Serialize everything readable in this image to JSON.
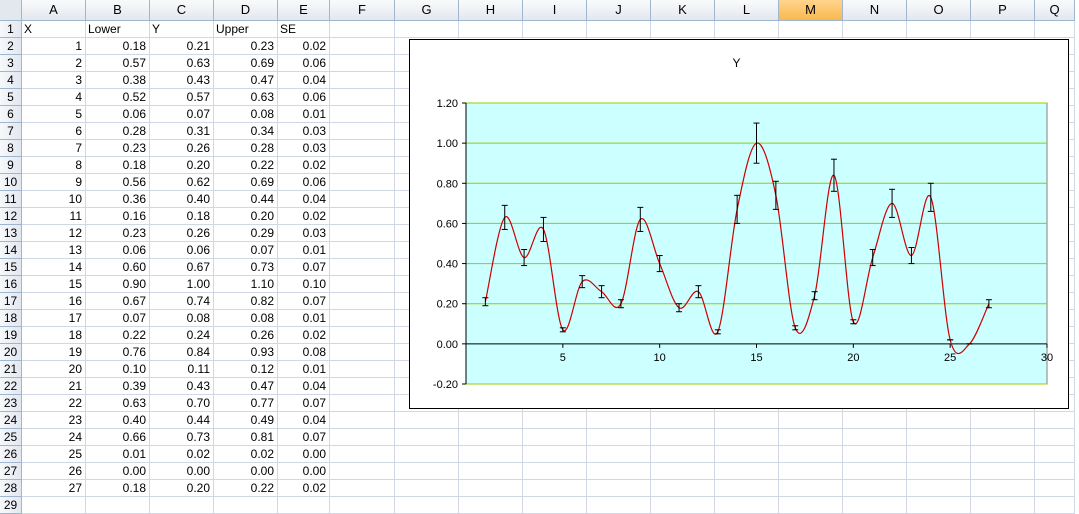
{
  "sheet": {
    "columns": [
      "A",
      "B",
      "C",
      "D",
      "E",
      "F",
      "G",
      "H",
      "I",
      "J",
      "K",
      "L",
      "M",
      "N",
      "O",
      "P",
      "Q"
    ],
    "selected_column": "M",
    "headers": [
      "X",
      "Lower",
      "Y",
      "Upper",
      "SE"
    ],
    "rows": [
      [
        "1",
        "0.18",
        "0.21",
        "0.23",
        "0.02"
      ],
      [
        "2",
        "0.57",
        "0.63",
        "0.69",
        "0.06"
      ],
      [
        "3",
        "0.38",
        "0.43",
        "0.47",
        "0.04"
      ],
      [
        "4",
        "0.52",
        "0.57",
        "0.63",
        "0.06"
      ],
      [
        "5",
        "0.06",
        "0.07",
        "0.08",
        "0.01"
      ],
      [
        "6",
        "0.28",
        "0.31",
        "0.34",
        "0.03"
      ],
      [
        "7",
        "0.23",
        "0.26",
        "0.28",
        "0.03"
      ],
      [
        "8",
        "0.18",
        "0.20",
        "0.22",
        "0.02"
      ],
      [
        "9",
        "0.56",
        "0.62",
        "0.69",
        "0.06"
      ],
      [
        "10",
        "0.36",
        "0.40",
        "0.44",
        "0.04"
      ],
      [
        "11",
        "0.16",
        "0.18",
        "0.20",
        "0.02"
      ],
      [
        "12",
        "0.23",
        "0.26",
        "0.29",
        "0.03"
      ],
      [
        "13",
        "0.06",
        "0.06",
        "0.07",
        "0.01"
      ],
      [
        "14",
        "0.60",
        "0.67",
        "0.73",
        "0.07"
      ],
      [
        "15",
        "0.90",
        "1.00",
        "1.10",
        "0.10"
      ],
      [
        "16",
        "0.67",
        "0.74",
        "0.82",
        "0.07"
      ],
      [
        "17",
        "0.07",
        "0.08",
        "0.08",
        "0.01"
      ],
      [
        "18",
        "0.22",
        "0.24",
        "0.26",
        "0.02"
      ],
      [
        "19",
        "0.76",
        "0.84",
        "0.93",
        "0.08"
      ],
      [
        "20",
        "0.10",
        "0.11",
        "0.12",
        "0.01"
      ],
      [
        "21",
        "0.39",
        "0.43",
        "0.47",
        "0.04"
      ],
      [
        "22",
        "0.63",
        "0.70",
        "0.77",
        "0.07"
      ],
      [
        "23",
        "0.40",
        "0.44",
        "0.49",
        "0.04"
      ],
      [
        "24",
        "0.66",
        "0.73",
        "0.81",
        "0.07"
      ],
      [
        "25",
        "0.01",
        "0.02",
        "0.02",
        "0.00"
      ],
      [
        "26",
        "0.00",
        "0.00",
        "0.00",
        "0.00"
      ],
      [
        "27",
        "0.18",
        "0.20",
        "0.22",
        "0.02"
      ]
    ]
  },
  "chart_data": {
    "type": "scatter",
    "title": "Y",
    "x": [
      1,
      2,
      3,
      4,
      5,
      6,
      7,
      8,
      9,
      10,
      11,
      12,
      13,
      14,
      15,
      16,
      17,
      18,
      19,
      20,
      21,
      22,
      23,
      24,
      25,
      26,
      27
    ],
    "y": [
      0.21,
      0.63,
      0.43,
      0.57,
      0.07,
      0.31,
      0.26,
      0.2,
      0.62,
      0.4,
      0.18,
      0.26,
      0.06,
      0.67,
      1.0,
      0.74,
      0.08,
      0.24,
      0.84,
      0.11,
      0.43,
      0.7,
      0.44,
      0.73,
      0.02,
      0.0,
      0.2
    ],
    "error": [
      0.02,
      0.06,
      0.04,
      0.06,
      0.01,
      0.03,
      0.03,
      0.02,
      0.06,
      0.04,
      0.02,
      0.03,
      0.01,
      0.07,
      0.1,
      0.07,
      0.01,
      0.02,
      0.08,
      0.01,
      0.04,
      0.07,
      0.04,
      0.07,
      0.0,
      0.0,
      0.02
    ],
    "xlim": [
      0,
      30
    ],
    "ylim": [
      -0.2,
      1.2
    ],
    "xticks": [
      "5",
      "10",
      "15",
      "20",
      "25",
      "30"
    ],
    "yticks": [
      "-0.20",
      "0.00",
      "0.20",
      "0.40",
      "0.60",
      "0.80",
      "1.00",
      "1.20"
    ],
    "plot_background": "#ccffff",
    "gridline_color": "#99cc00",
    "line_color": "#cc0000",
    "smoothed_line": true,
    "grid": true
  }
}
